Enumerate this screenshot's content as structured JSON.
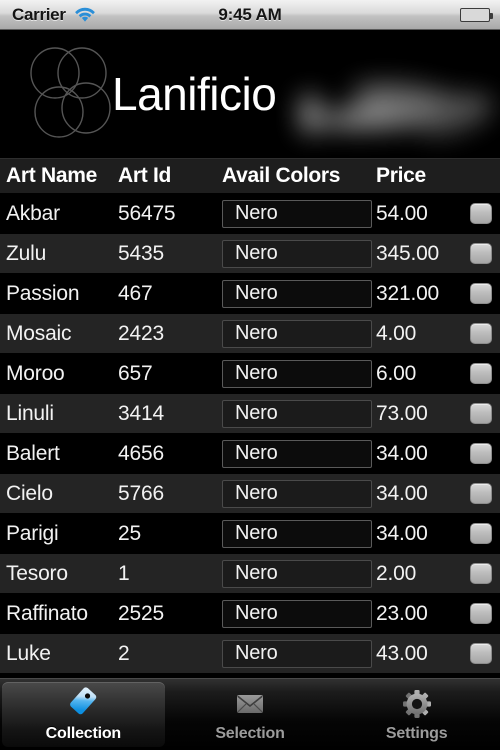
{
  "status_bar": {
    "carrier": "Carrier",
    "time": "9:45 AM",
    "wifi_icon": "wifi-icon",
    "battery_icon": "battery-icon"
  },
  "header": {
    "title": "Lanificio",
    "logo_icon": "overlapping-circles-logo",
    "redacted_icon": "blurred-redacted-graphic"
  },
  "table": {
    "columns": [
      "Art Name",
      "Art Id",
      "Avail Colors",
      "Price"
    ],
    "rows": [
      {
        "name": "Akbar",
        "id": "56475",
        "color": "Nero",
        "price": "54.00"
      },
      {
        "name": "Zulu",
        "id": "5435",
        "color": "Nero",
        "price": "345.00"
      },
      {
        "name": "Passion",
        "id": "467",
        "color": "Nero",
        "price": "321.00"
      },
      {
        "name": "Mosaic",
        "id": "2423",
        "color": "Nero",
        "price": "4.00"
      },
      {
        "name": "Moroo",
        "id": "657",
        "color": "Nero",
        "price": "6.00"
      },
      {
        "name": "Linuli",
        "id": "3414",
        "color": "Nero",
        "price": "73.00"
      },
      {
        "name": "Balert",
        "id": "4656",
        "color": "Nero",
        "price": "34.00"
      },
      {
        "name": "Cielo",
        "id": "5766",
        "color": "Nero",
        "price": "34.00"
      },
      {
        "name": "Parigi",
        "id": "25",
        "color": "Nero",
        "price": "34.00"
      },
      {
        "name": "Tesoro",
        "id": "1",
        "color": "Nero",
        "price": "2.00"
      },
      {
        "name": "Raffinato",
        "id": "2525",
        "color": "Nero",
        "price": "23.00"
      },
      {
        "name": "Luke",
        "id": "2",
        "color": "Nero",
        "price": "43.00"
      }
    ]
  },
  "tab_bar": {
    "selected": "Collection",
    "tabs": [
      {
        "label": "Collection",
        "icon": "tag-icon"
      },
      {
        "label": "Selection",
        "icon": "envelope-icon"
      },
      {
        "label": "Settings",
        "icon": "gear-icon"
      }
    ]
  },
  "colors": {
    "background": "#000000",
    "row_alt": "#242424",
    "header_row": "#1e1e1e",
    "accent_tag": "#3aa7ee",
    "battery_green": "#4cc52a",
    "wifi_blue": "#2b8fd8"
  }
}
